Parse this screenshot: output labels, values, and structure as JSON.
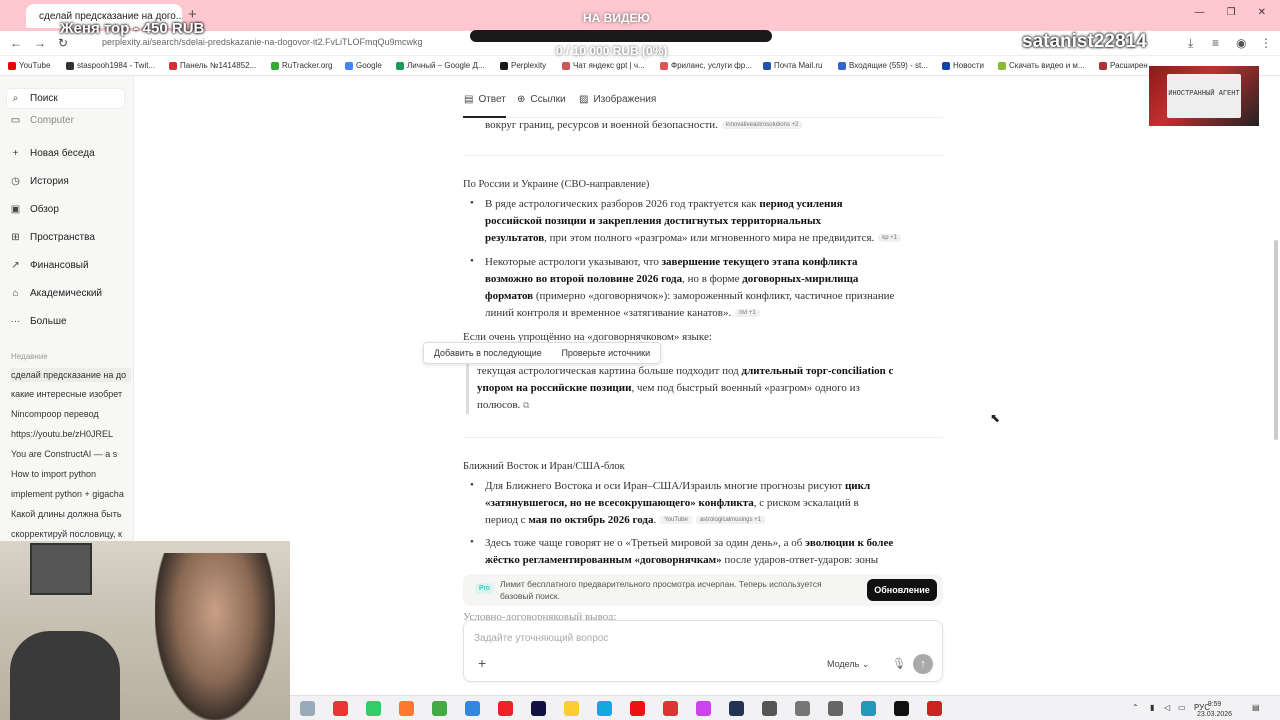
{
  "browser": {
    "tab_title": "сделай предсказание на дого...",
    "url": "perplexity.ai/search/sdelai-predskazanie-na-dogovor-it2.FvLiTLOFmqQu9mcwkg",
    "bookmarks": [
      "YouTube",
      "staspooh1984 - Twit...",
      "Панель №1414852...",
      "RuTracker.org",
      "Google",
      "Личный – Google Д...",
      "Perplexity",
      "Чат яндекс gpt | ч...",
      "Фриланс, услуги фр...",
      "Почта Mail.ru",
      "Входящие (559) - st...",
      "Новости",
      "Скачать видео и м...",
      "Расширен"
    ]
  },
  "stream_overlay": {
    "top_text": "Женя тор - 450 RUB",
    "goal_label": "НА ВИДЕЮ",
    "goal_progress_text": "0 / 10 000 RUB (0%)",
    "goal_progress_fraction": 0,
    "username": "satanist22814",
    "cam_label": "ИНОСТРАННЫЙ АГЕНТ"
  },
  "sidebar": {
    "items": [
      {
        "label": "Поиск",
        "icon": "search-icon"
      },
      {
        "label": "Computer",
        "icon": "computer-icon"
      },
      {
        "label": "Новая беседа",
        "icon": "plus-icon"
      },
      {
        "label": "История",
        "icon": "history-icon"
      },
      {
        "label": "Обзор",
        "icon": "discover-icon"
      },
      {
        "label": "Пространства",
        "icon": "spaces-icon"
      },
      {
        "label": "Финансовый",
        "icon": "chart-icon"
      },
      {
        "label": "Академический",
        "icon": "academic-icon"
      },
      {
        "label": "Больше",
        "icon": "more-icon"
      }
    ],
    "recent_label": "Недавние",
    "history": [
      "сделай предсказание на до",
      "какие интересные изобрет",
      "Nincompoop перевод",
      "https://youtu.be/zH0JREL",
      "You are ConstructAI — a s",
      "How to import python",
      "implement python + gigacha",
      "Какой длины должна быть",
      "скорректируй пословицу, к"
    ]
  },
  "tabs": {
    "answer": "Ответ",
    "links": "Ссылки",
    "images": "Изображения"
  },
  "content": {
    "line0": "вокруг границ, ресурсов и военной безопасности.",
    "line0_src": "innovativeastrosolutions +2",
    "h_russia": "По России и Украине (СВО-направление)",
    "b1_a": "В ряде астрологических разборов 2026 год трактуется как ",
    "b1_b": "период усиления",
    "b1_c": "российской позиции и закрепления достигнутых территориальных",
    "b1_d": "результатов",
    "b1_e": ", при этом полного «разгрома» или мгновенного мира не предвидится.",
    "b1_src": "kp +1",
    "b2_a": "Некоторые астрологи указывают, что ",
    "b2_b": "завершение текущего этапа конфликта",
    "b2_c": "возможно во второй половине 2026 года",
    "b2_d": ", но в форме ",
    "b2_e": "договорных-мирилища",
    "b2_f": "форматов",
    "b2_g": " (примерно «договорнячок»): замороженный конфликт, частичное признание",
    "b2_h": "линий контроля и временное «затягивание канатов».",
    "b2_src": "rtvi +1",
    "simple": "Если очень упрощённо на «договорнячковом» языке:",
    "popup_add": "Добавить в последующие",
    "popup_check": "Проверьте источники",
    "q_a": "текущая астрологическая картина больше подходит под ",
    "q_b": "длительный торг-conciliation с",
    "q_c": "упором на российские позиции",
    "q_d": ", чем под быстрый военный «разгром» одного из",
    "q_e": "полюсов.",
    "h_mideast": "Ближний Восток и Иран/США-блок",
    "b3_a": "Для Ближнего Востока и оси Иран–США/Израиль многие прогнозы рисуют ",
    "b3_b": "цикл",
    "b3_c": "«затянувшегося, но не всесокрушающего» конфликта",
    "b3_d": ", с риском эскалаций в",
    "b3_e": "период с ",
    "b3_f": "мая по октябрь 2026 года",
    "b3_src1": "YouTube",
    "b3_src2": "astrologicalmusings +1",
    "b4_a": "Здесь тоже чаще говорят не о «Третьей мировой за один день», а об ",
    "b4_b": "эволюции к более",
    "b4_c": "жёстко регламентированным «договорнячкам»",
    "b4_d": " после ударов-ответ-ударов: зоны",
    "cut": "Условно-договорняковый вывод:"
  },
  "banner": {
    "pro": "Pro",
    "text": "Лимит бесплатного предварительного просмотра исчерпан. Теперь используется базовый поиск.",
    "upgrade": "Обновление"
  },
  "input": {
    "placeholder": "Задайте уточняющий вопрос",
    "model": "Модель"
  },
  "taskbar": {
    "lang": "РУС",
    "time": "9:59",
    "date": "23.03.2026"
  },
  "colors": {
    "tabbar_bg": "#ffc8d0",
    "accent": "#111111"
  }
}
